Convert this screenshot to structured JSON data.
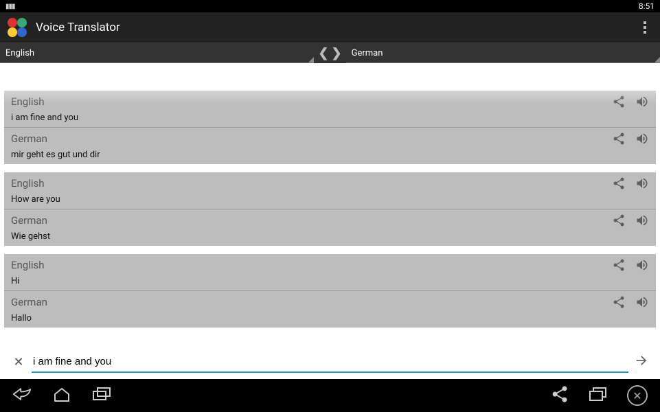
{
  "status": {
    "time": "8:51"
  },
  "header": {
    "title": "Voice Translator"
  },
  "languages": {
    "source": "English",
    "target": "German"
  },
  "conversations": [
    {
      "pair": [
        {
          "lang": "English",
          "text": "i am fine and you"
        },
        {
          "lang": "German",
          "text": "mir geht es gut und dir"
        }
      ]
    },
    {
      "pair": [
        {
          "lang": "English",
          "text": "How are you"
        },
        {
          "lang": "German",
          "text": "Wie gehst"
        }
      ]
    },
    {
      "pair": [
        {
          "lang": "English",
          "text": "Hi"
        },
        {
          "lang": "German",
          "text": "Hallo"
        }
      ]
    }
  ],
  "input": {
    "value": "i am fine and you"
  }
}
